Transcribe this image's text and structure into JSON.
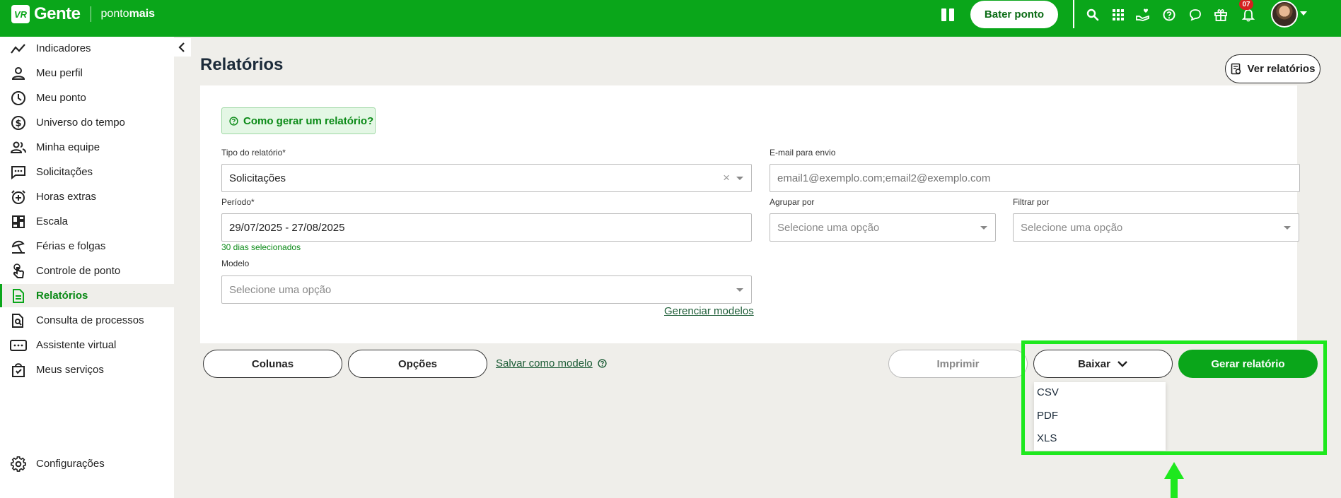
{
  "topbar": {
    "brand_badge": "VR",
    "brand_name": "Gente",
    "product_prefix": "ponto",
    "product_suffix": "mais",
    "bater_ponto": "Bater ponto",
    "notification_count": "07",
    "icons": [
      "pause-icon",
      "search-icon",
      "apps-grid-icon",
      "hand-heart-icon",
      "help-circle-icon",
      "chat-icon",
      "gift-icon",
      "bell-icon"
    ],
    "colors": {
      "brand_green": "#0aa61a",
      "badge_red": "#d42020"
    }
  },
  "sidebar": {
    "items": [
      {
        "label": "Indicadores",
        "icon": "trend-line-icon"
      },
      {
        "label": "Meu perfil",
        "icon": "user-icon"
      },
      {
        "label": "Meu ponto",
        "icon": "clock-icon"
      },
      {
        "label": "Universo do tempo",
        "icon": "dollar-circle-icon"
      },
      {
        "label": "Minha equipe",
        "icon": "team-icon"
      },
      {
        "label": "Solicitações",
        "icon": "message-dots-icon"
      },
      {
        "label": "Horas extras",
        "icon": "alarm-plus-icon"
      },
      {
        "label": "Escala",
        "icon": "dashboard-icon"
      },
      {
        "label": "Férias e folgas",
        "icon": "umbrella-icon"
      },
      {
        "label": "Controle de ponto",
        "icon": "finger-touch-icon"
      },
      {
        "label": "Relatórios",
        "icon": "document-icon",
        "active": true
      },
      {
        "label": "Consulta de processos",
        "icon": "document-search-icon"
      },
      {
        "label": "Assistente virtual",
        "icon": "assistant-icon"
      },
      {
        "label": "Meus serviços",
        "icon": "shopping-bag-icon"
      }
    ],
    "settings": {
      "label": "Configurações",
      "icon": "gear-icon"
    }
  },
  "main": {
    "title": "Relatórios",
    "ver_relatorios": "Ver relatórios",
    "help": "Como gerar um relatório?",
    "tipo": {
      "label": "Tipo do relatório*",
      "value": "Solicitações"
    },
    "email": {
      "label": "E-mail para envio",
      "placeholder": "email1@exemplo.com;email2@exemplo.com"
    },
    "periodo": {
      "label": "Período*",
      "value": "29/07/2025 - 27/08/2025",
      "hint": "30 dias selecionados"
    },
    "agrupar": {
      "label": "Agrupar por",
      "placeholder": "Selecione uma opção"
    },
    "filtrar": {
      "label": "Filtrar por",
      "placeholder": "Selecione uma opção"
    },
    "modelo": {
      "label": "Modelo",
      "placeholder": "Selecione uma opção"
    },
    "gerenciar_modelos": "Gerenciar modelos"
  },
  "actions": {
    "colunas": "Colunas",
    "opcoes": "Opções",
    "salvar_modelo": "Salvar como modelo",
    "imprimir": "Imprimir",
    "baixar": "Baixar",
    "gerar": "Gerar relatório",
    "baixar_options": [
      "CSV",
      "PDF",
      "XLS"
    ]
  },
  "annotation": {
    "highlight_color": "#1ee81e"
  }
}
